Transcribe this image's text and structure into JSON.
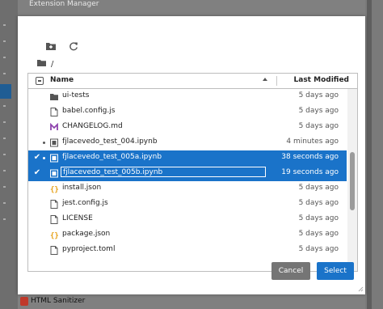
{
  "background": {
    "top_title": "Extension Manager",
    "bottom_item": "HTML Sanitizer"
  },
  "dialog": {
    "toolbar": {
      "new_folder_icon": "new-folder-icon",
      "refresh_icon": "refresh-icon"
    },
    "breadcrumb": {
      "icon": "folder-icon",
      "path": "/"
    },
    "header": {
      "name": "Name",
      "last_modified": "Last Modified",
      "sort": "ascending"
    },
    "files": [
      {
        "name": "ui-tests",
        "modified": "5 days ago",
        "type": "folder",
        "selected": false,
        "running": false
      },
      {
        "name": "babel.config.js",
        "modified": "5 days ago",
        "type": "file",
        "selected": false,
        "running": false
      },
      {
        "name": "CHANGELOG.md",
        "modified": "5 days ago",
        "type": "markdown",
        "selected": false,
        "running": false
      },
      {
        "name": "fjlacevedo_test_004.ipynb",
        "modified": "4 minutes ago",
        "type": "notebook",
        "selected": false,
        "running": true
      },
      {
        "name": "fjlacevedo_test_005a.ipynb",
        "modified": "38 seconds ago",
        "type": "notebook",
        "selected": true,
        "running": true
      },
      {
        "name": "fjlacevedo_test_005b.ipynb",
        "modified": "19 seconds ago",
        "type": "notebook",
        "selected": true,
        "running": false,
        "editing": true
      },
      {
        "name": "install.json",
        "modified": "5 days ago",
        "type": "json",
        "selected": false,
        "running": false
      },
      {
        "name": "jest.config.js",
        "modified": "5 days ago",
        "type": "file",
        "selected": false,
        "running": false
      },
      {
        "name": "LICENSE",
        "modified": "5 days ago",
        "type": "file",
        "selected": false,
        "running": false
      },
      {
        "name": "package.json",
        "modified": "5 days ago",
        "type": "json",
        "selected": false,
        "running": false
      },
      {
        "name": "pyproject.toml",
        "modified": "5 days ago",
        "type": "file",
        "selected": false,
        "running": false
      }
    ],
    "buttons": {
      "cancel": "Cancel",
      "select": "Select"
    },
    "colors": {
      "accent": "#1a73c9",
      "markdown_icon": "#8e44ad",
      "json_icon": "#e6a118",
      "cancel_bg": "#757575"
    }
  }
}
